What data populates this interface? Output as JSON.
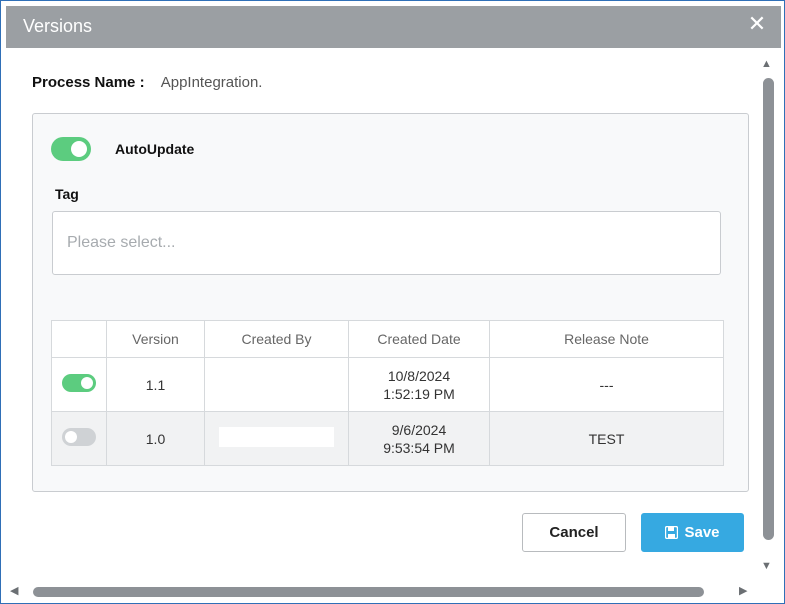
{
  "dialog": {
    "title": "Versions",
    "close_icon": "close-icon"
  },
  "process": {
    "label": "Process Name :",
    "value": "AppIntegration."
  },
  "autoupdate": {
    "label": "AutoUpdate",
    "enabled": true,
    "color": "#5ccc7f"
  },
  "tag": {
    "label": "Tag",
    "placeholder": "Please select..."
  },
  "table": {
    "headers": [
      "",
      "Version",
      "Created By",
      "Created Date",
      "Release Note"
    ],
    "rows": [
      {
        "active": true,
        "version": "1.1",
        "created_by": "",
        "date": "10/8/2024",
        "time": "1:52:19 PM",
        "note": "---"
      },
      {
        "active": false,
        "version": "1.0",
        "created_by": "",
        "date": "9/6/2024",
        "time": "9:53:54 PM",
        "note": "TEST"
      }
    ]
  },
  "buttons": {
    "cancel": "Cancel",
    "save": "Save",
    "save_color": "#36a9e1"
  },
  "colors": {
    "titlebar": "#9b9fa3",
    "border": "#2f6fb7"
  }
}
